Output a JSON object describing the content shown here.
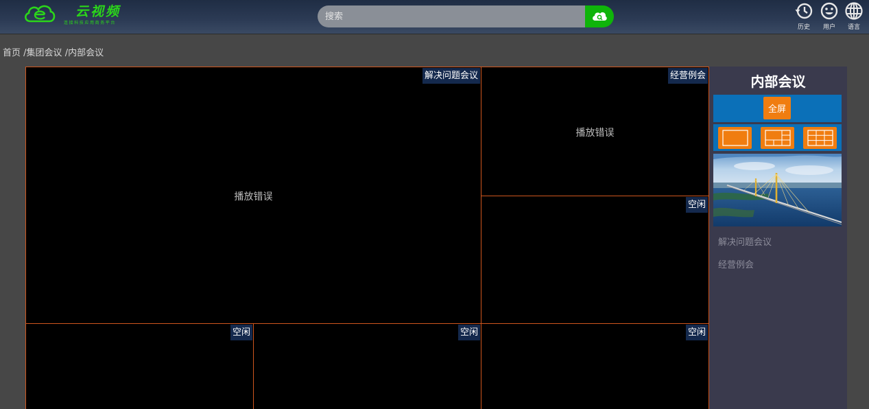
{
  "header": {
    "logo_title": "云视频",
    "logo_subtitle": "连接科技应用商务平台",
    "search": {
      "placeholder": "搜索",
      "value": ""
    },
    "search_icon": "cloud-search-icon",
    "actions": [
      {
        "label": "历史",
        "icon": "history-icon"
      },
      {
        "label": "用户",
        "icon": "user-smile-icon"
      },
      {
        "label": "语言",
        "icon": "globe-icon"
      }
    ],
    "colors": {
      "brand_green": "#2bd61a",
      "search_button": "#0fb40a"
    }
  },
  "breadcrumb": {
    "items": [
      "首页",
      "集团会议",
      "内部会议"
    ],
    "separator": "/"
  },
  "video_cells": [
    {
      "tag": "解决问题会议",
      "message": "播放错误"
    },
    {
      "tag": "经营例会",
      "message": "播放错误"
    },
    {
      "tag": "空闲",
      "message": ""
    },
    {
      "tag": "空闲",
      "message": ""
    },
    {
      "tag": "空闲",
      "message": ""
    },
    {
      "tag": "空闲",
      "message": ""
    }
  ],
  "panel": {
    "title": "内部会议",
    "fullscreen_label": "全屏",
    "layouts": [
      {
        "name": "single",
        "icon": "layout-1-icon"
      },
      {
        "name": "1+5",
        "icon": "layout-6-icon"
      },
      {
        "name": "3x3",
        "icon": "layout-9-icon"
      }
    ],
    "thumbnail": "bridge-photo",
    "meetings": [
      "解决问题会议",
      "经营例会"
    ],
    "colors": {
      "accent_orange": "#f07d10",
      "bar_blue": "#0b70b8",
      "cell_border": "#d0561e"
    }
  }
}
